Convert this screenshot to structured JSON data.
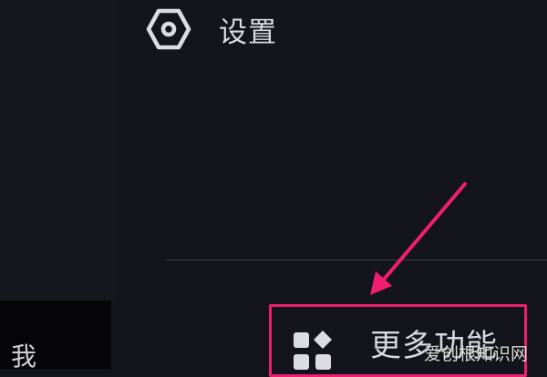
{
  "menu": {
    "settings": {
      "label": "设置",
      "icon": "hexagon-gear-icon"
    },
    "more_features": {
      "label": "更多功能",
      "icon": "grid-apps-icon"
    }
  },
  "bottom_nav": {
    "me_label": "我"
  },
  "watermark": {
    "text": "爱创根知识网"
  },
  "colors": {
    "background": "#14141d",
    "highlight": "#f01e6e",
    "text": "#d9d9e0"
  }
}
